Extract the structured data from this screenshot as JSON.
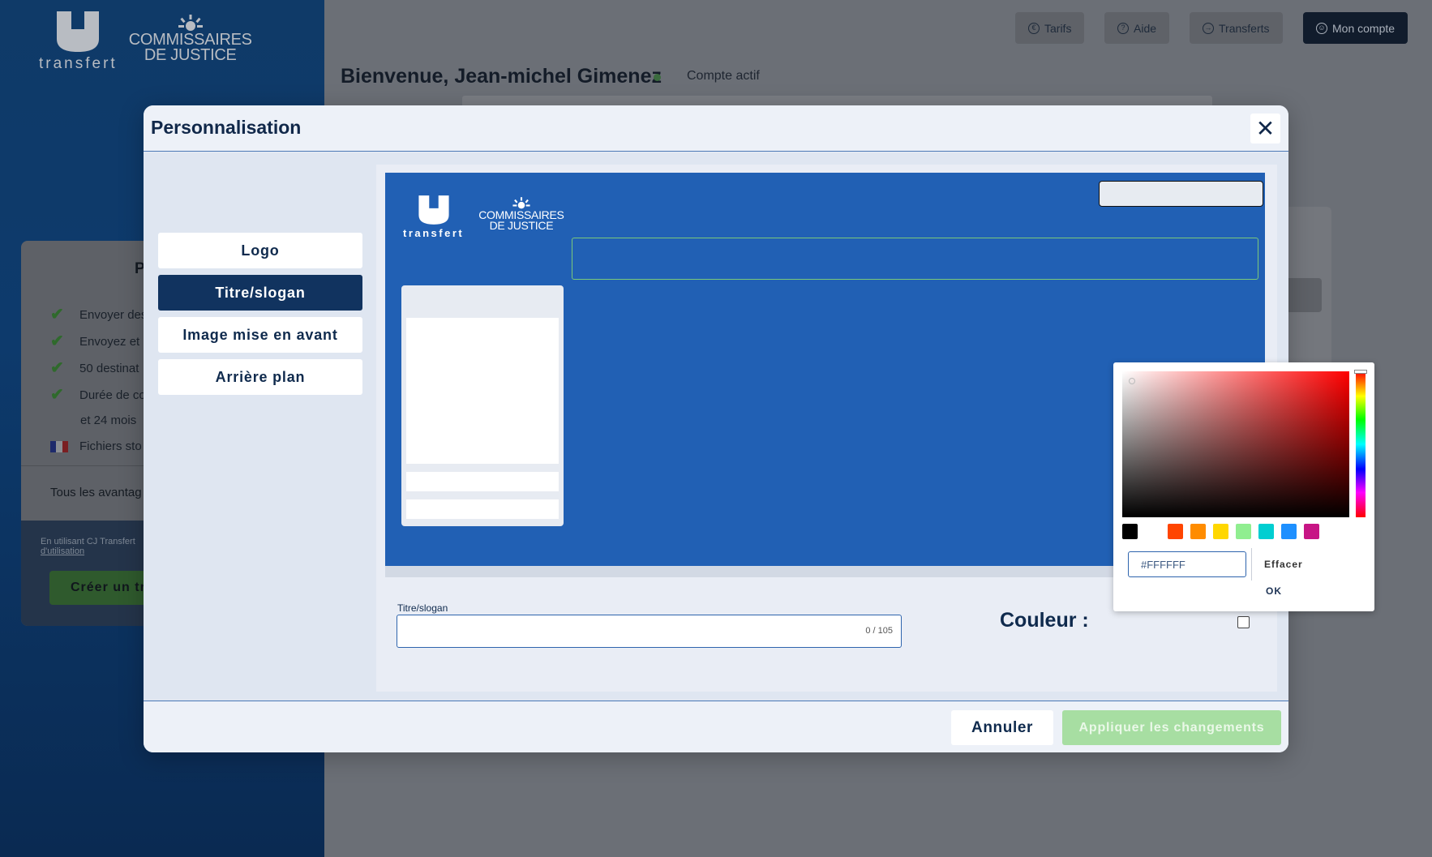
{
  "app": {
    "brand_mark_text": "transfert",
    "brand_cj_line1": "COMMISSAIRES",
    "brand_cj_line2": "DE JUSTICE"
  },
  "topnav": {
    "items": [
      {
        "label": "Tarifs",
        "icon": "euro-icon"
      },
      {
        "label": "Aide",
        "icon": "help-icon"
      },
      {
        "label": "Transferts",
        "icon": "transfer-icon"
      },
      {
        "label": "Mon compte",
        "icon": "user-icon"
      }
    ]
  },
  "page": {
    "welcome": "Bienvenue, Jean-michel Gimenez",
    "status": "Compte actif",
    "status_color": "#3b6b3e"
  },
  "plan_card": {
    "heading": "P",
    "features": [
      "Envoyer des",
      "Envoyez et",
      "50 destinat",
      "Durée de co",
      "et 24 mois",
      "Fichiers sto"
    ],
    "all_link": "Tous les avantag",
    "terms_line1": "En utilisant CJ Transfert",
    "terms_line2": "d'utilisation",
    "create_button": "Créer un tr"
  },
  "modal": {
    "title": "Personnalisation",
    "menu": [
      {
        "label": "Logo",
        "active": false
      },
      {
        "label": "Titre/slogan",
        "active": true
      },
      {
        "label": "Image mise en avant",
        "active": false
      },
      {
        "label": "Arrière plan",
        "active": false
      }
    ],
    "preview": {
      "background_color": "#2160b4",
      "logo_mark_text": "transfert",
      "cj_line1": "COMMISSAIRES",
      "cj_line2": "DE JUSTICE"
    },
    "field_label": "Titre/slogan",
    "field_value": "",
    "field_counter": "0 / 105",
    "color_label": "Couleur :",
    "cancel": "Annuler",
    "apply": "Appliquer les changements"
  },
  "color_picker": {
    "hex_value": "#FFFFFF",
    "clear": "Effacer",
    "ok": "OK",
    "swatches": [
      "#000000",
      "#ffffff",
      "#ff4500",
      "#ff8c00",
      "#ffd700",
      "#90ee90",
      "#00ced1",
      "#1e90ff",
      "#c71585"
    ]
  }
}
